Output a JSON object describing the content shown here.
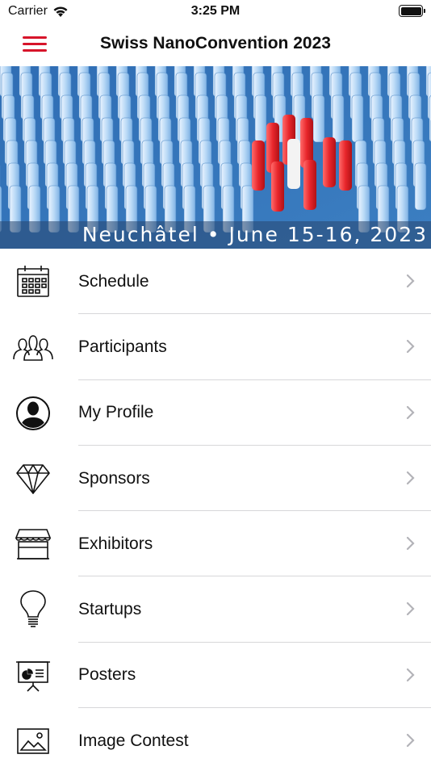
{
  "status_bar": {
    "carrier": "Carrier",
    "time": "3:25 PM"
  },
  "nav": {
    "title": "Swiss NanoConvention 2023",
    "accent_color": "#d7142a"
  },
  "banner": {
    "caption": "Neuchâtel • June 15-16, 2023"
  },
  "menu": {
    "items": [
      {
        "label": "Schedule",
        "icon": "calendar-icon"
      },
      {
        "label": "Participants",
        "icon": "people-group-icon"
      },
      {
        "label": "My Profile",
        "icon": "profile-avatar-icon"
      },
      {
        "label": "Sponsors",
        "icon": "diamond-icon"
      },
      {
        "label": "Exhibitors",
        "icon": "storefront-icon"
      },
      {
        "label": "Startups",
        "icon": "lightbulb-icon"
      },
      {
        "label": "Posters",
        "icon": "presentation-board-icon"
      },
      {
        "label": "Image Contest",
        "icon": "image-icon"
      }
    ]
  }
}
